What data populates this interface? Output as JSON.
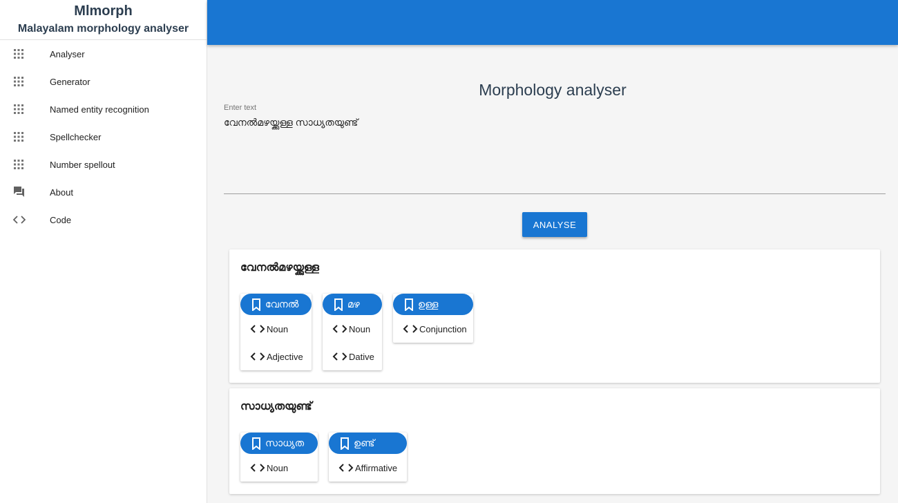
{
  "app": {
    "title": "Mlmorph",
    "subtitle": "Malayalam morphology analyser"
  },
  "sidebar": {
    "items": [
      {
        "label": "Analyser",
        "icon": "apps-grid-icon"
      },
      {
        "label": "Generator",
        "icon": "apps-grid-icon"
      },
      {
        "label": "Named entity recognition",
        "icon": "apps-grid-icon"
      },
      {
        "label": "Spellchecker",
        "icon": "apps-grid-icon"
      },
      {
        "label": "Number spellout",
        "icon": "apps-grid-icon"
      },
      {
        "label": "About",
        "icon": "forum-icon"
      },
      {
        "label": "Code",
        "icon": "code-icon"
      }
    ]
  },
  "main": {
    "title": "Morphology analyser",
    "input": {
      "label": "Enter text",
      "value": "വേനൽമഴയ്ക്കുള്ള സാധ്യതയുണ്ട്"
    },
    "analyse_label": "ANALYSE"
  },
  "results": [
    {
      "word": "വേനൽമഴയ്ക്കുള്ള",
      "morphemes": [
        {
          "root": "വേനൽ",
          "tags": [
            "Noun",
            "Adjective"
          ]
        },
        {
          "root": "മഴ",
          "tags": [
            "Noun",
            "Dative"
          ]
        },
        {
          "root": "ഉള്ള",
          "tags": [
            "Conjunction"
          ]
        }
      ]
    },
    {
      "word": "സാധ്യതയുണ്ട്",
      "morphemes": [
        {
          "root": "സാധ്യത",
          "tags": [
            "Noun"
          ]
        },
        {
          "root": "ഉണ്ട്",
          "tags": [
            "Affirmative"
          ]
        }
      ]
    }
  ],
  "colors": {
    "primary": "#1976d2",
    "background": "#f5f5f5",
    "title": "#2c3e50"
  }
}
